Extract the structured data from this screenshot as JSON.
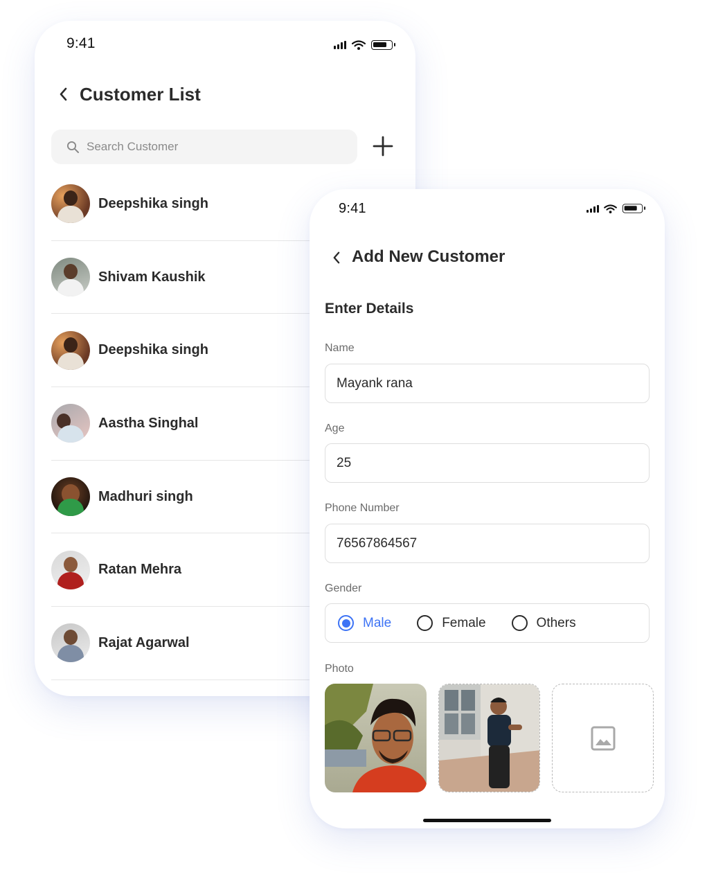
{
  "list_screen": {
    "status_time": "9:41",
    "title": "Customer List",
    "search_placeholder": "Search Customer",
    "customers": [
      {
        "name": "Deepshika singh"
      },
      {
        "name": "Shivam Kaushik"
      },
      {
        "name": "Deepshika singh"
      },
      {
        "name": "Aastha Singhal"
      },
      {
        "name": "Madhuri singh"
      },
      {
        "name": "Ratan Mehra"
      },
      {
        "name": "Rajat Agarwal"
      }
    ]
  },
  "add_screen": {
    "status_time": "9:41",
    "title": "Add New Customer",
    "section_title": "Enter Details",
    "name_label": "Name",
    "name_value": "Mayank rana",
    "age_label": "Age",
    "age_value": "25",
    "phone_label": "Phone Number",
    "phone_value": "76567864567",
    "gender_label": "Gender",
    "gender_options": [
      "Male",
      "Female",
      "Others"
    ],
    "gender_selected": "Male",
    "photo_label": "Photo"
  },
  "icons": {
    "back": "chevron-left-icon",
    "search": "search-icon",
    "add": "plus-icon",
    "photo_placeholder": "image-icon",
    "signal": "signal-icon",
    "wifi": "wifi-icon",
    "battery": "battery-icon"
  },
  "colors": {
    "accent": "#3d73f5",
    "text": "#2b2b2b",
    "divider": "#e6e6e6",
    "search_bg": "#f4f4f4"
  }
}
